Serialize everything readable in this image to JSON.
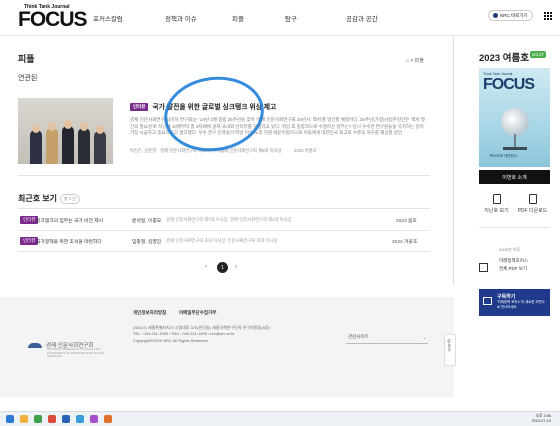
{
  "header": {
    "logo_tagline": "Think Tank Journal",
    "logo_name": "FOCUS",
    "nav": [
      "포커스칼럼",
      "정책과 이슈",
      "피플",
      "탐구",
      "공감과 공간"
    ],
    "nrc_button": "NRC 바로가기"
  },
  "page": {
    "title": "피플",
    "subtitle": "연관된",
    "breadcrumb": "⌂  >  피플"
  },
  "featured": {
    "badge": "인터뷰",
    "title": "국가 발전을 위한 글로벌 싱크탱크 위상 제고",
    "description": "경제·인문사회연구회(이하 연구회)는 '24년 3월 창립 25주년을 맞아 '경제·인문사회연구회 25년사: 백서'를 발간할 예정이다. 25주년(가칭)사업추진단은 '백서 발간의 필요성'로 지난해 10월부터 총 4차례에 걸쳐 국내외 인터뷰를 진행하고 있다. 취임 후 종합적으로 수행하신 업무는? 당시 우수한 연구원들을 유치하는 일이 가장 시급하고 중요하다고 생각했다. 우수 연구 인력들이 떠날 이유 노후 지원 때문이었으므로 이들에게 대한민국 최고의 수준의 처우를 제공할 방안",
    "meta": [
      "박진곤, 김준영",
      "경제·인문사회연구회 제18대 이사장",
      "경제·인문사회연구회 제8대 이사장",
      "2023 여름호"
    ]
  },
  "recent": {
    "title": "최근호 보기",
    "count": "총 2 건",
    "rows": [
      {
        "badge": "인터뷰",
        "title": "싱크탱크의 임무는 국가 비전 제시",
        "people": "윤석일, 이종오",
        "desc": "경제·인문사회연구회 제7대 이사장,  경제·인문사회연구회 제2대 이사장",
        "date": "2023 봄호"
      },
      {
        "badge": "인터뷰",
        "title": "국가정책을 위한 조석을 마련하다",
        "people": "임충철, 김영진",
        "desc": "경제·인문사회연구회 초대 이사장,  인문사회연구회 초대 이사장",
        "date": "2022 겨울호"
      }
    ]
  },
  "pager": {
    "prev": "‹",
    "current": "1",
    "next": "›"
  },
  "sidebar": {
    "issue_title": "2023 여름호",
    "vol_badge": "vol.37",
    "cover_strip": "Think Tank Journal",
    "cover_logo": "FOCUS",
    "cover_caption": "'목소리에' 대변한다",
    "view_issue": "이번호 소개",
    "link_web": "지난호 보기",
    "link_pdf": "PDF 다운로드",
    "archive_note": "2009년 이후",
    "archive_l1": "미래정책포커스",
    "archive_l2": "전체 PDF 보기",
    "subscribe_title": "구독하기",
    "subscribe_desc": "'미래정책 포커스'의 새로운 지면으로 만나보세요"
  },
  "footer": {
    "org_name": "경제·인문사회연구회",
    "org_en": "NATIONAL RESEARCH COUNCIL FOR ECONOMICS, HUMANITIES AND SOCIAL SCIENCES",
    "link_privacy": "개인정보처리방침",
    "link_email": "이메일무단수집거부",
    "address": "(30147) 세종특별자치시 시청대로 370(반곡동) 세종국책연구단지 연구지원동(A동)",
    "contact": "TEL : 044-211-1000 / FAX : 044-211-1499 / nrc@nrc.re.kr",
    "copyright": "Copyright©2020 NRC All Rights Reserved",
    "related_sites": "관련사이트",
    "quick": "QUICK"
  },
  "taskbar": {
    "time": "오후 3:56",
    "date": "2023-07-19"
  },
  "colors": {
    "badge": "#7a2a8a",
    "vol_badge": "#4cae4c",
    "subscribe": "#1f3a8a",
    "annotation_ring": "#1e7fd6"
  }
}
